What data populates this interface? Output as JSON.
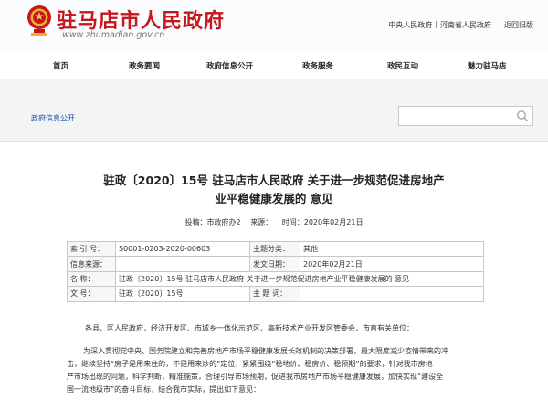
{
  "header": {
    "site_title": "驻马店市人民政府",
    "site_url": "www.zhumadian.gov.cn",
    "links": [
      "中央人民政府",
      "河南省人民政府",
      "返回旧版"
    ],
    "link_sep": "|",
    "brand_red": "#c8161d"
  },
  "nav": {
    "items": [
      "首页",
      "政务要闻",
      "政府信息公开",
      "政务服务",
      "政民互动",
      "魅力驻马店"
    ]
  },
  "breadcrumb": {
    "label": "政府信息公开"
  },
  "search": {
    "placeholder": "",
    "icon": "search-icon"
  },
  "document": {
    "title_line1": "驻政〔2020〕15号 驻马店市人民政府 关于进一步规范促进房地产",
    "title_line2": "业平稳健康发展的 意见",
    "meta": {
      "poster_label": "投稿：",
      "poster_value": "市政府办2",
      "source_label": "来源：",
      "source_value": "",
      "date_label": "时间：",
      "date_value": "2020年02月21日"
    },
    "info_table": {
      "index_label": "索 引 号：",
      "index_value": "S0001-0203-2020-00603",
      "category_label": "主题分类：",
      "category_value": "其他",
      "origin_label": "信息来源：",
      "origin_value": "",
      "issue_date_label": "发文日期：",
      "issue_date_value": "2020年02月21日",
      "name_label": "名       称：",
      "name_value": "驻政〔2020〕15号 驻马店市人民政府 关于进一步规范促进房地产业平稳健康发展的 意见",
      "doc_no_label": "文       号：",
      "doc_no_value": "驻政〔2020〕15号",
      "keywords_label": "主 题 词：",
      "keywords_value": ""
    },
    "body": {
      "salutation": "各县、区人民政府，经济开发区、市城乡一体化示范区、高新技术产业开发区管委会，市直有关单位：",
      "para1_line1": "为深入贯彻党中央、国务院建立和完善房地产市场平稳健康发展长效机制的决策部署，最大限度减少疫情带来的冲",
      "para1_line2": "击，继续坚持“房子是用来住的，不是用来炒的”定位，紧紧围绕“稳地价、稳房价、稳预期”的要求，针对我市房地",
      "para1_line3": "产市场出现的问题，科学判断，精准施策，合理引导市场预期，促进我市房地产市场平稳健康发展，加快实现“建设全",
      "para1_line4": "国一流地级市”的奋斗目标，结合我市实际，提出如下意见："
    }
  }
}
